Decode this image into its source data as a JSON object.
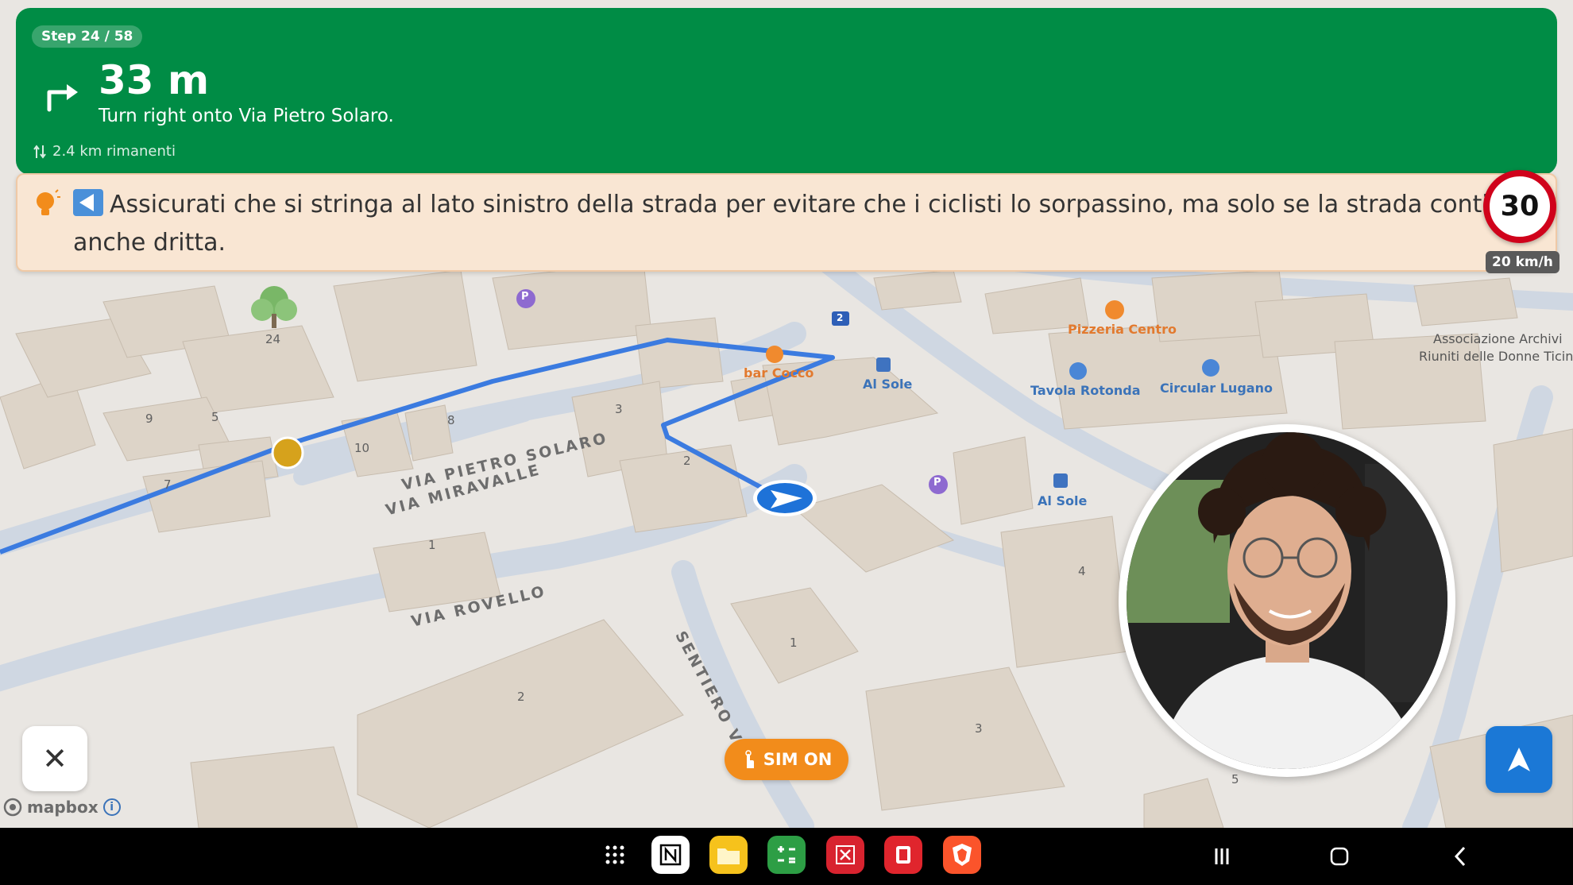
{
  "navigation": {
    "step": "Step 24 / 58",
    "distance": "33 m",
    "instruction": "Turn right onto Via Pietro Solaro.",
    "remaining": "2.4 km rimanenti",
    "turn_icon": "turn-right-icon",
    "banner_color": "#008c45"
  },
  "tip": {
    "icon": "lightbulb-icon",
    "text": "Assicurati che si stringa al lato sinistro della strada per evitare che i ciclisti lo sorpassino, ma solo se la strada continua anche dritta.",
    "background": "#f9e6d3"
  },
  "speed": {
    "limit": "30",
    "current": "20 km/h"
  },
  "map": {
    "streets": [
      "VIA PIETRO SOLARO",
      "VIA MIRAVALLE",
      "VIA ROVELLO",
      "SENTIERO VI"
    ],
    "pois": [
      "bar Cocco",
      "Al Sole",
      "Pizzeria Centro",
      "Tavola Rotonda",
      "Circular Lugano",
      "Al Sole",
      "Associazione Archivi",
      "Riuniti delle Donne Ticin"
    ],
    "building_numbers": [
      "24",
      "9",
      "5",
      "8",
      "10",
      "3",
      "2",
      "1",
      "1",
      "2",
      "3",
      "4",
      "5",
      "7"
    ],
    "route_badge": "2",
    "parking": "P",
    "route_color": "#3b7be0"
  },
  "controls": {
    "close": "✕",
    "sim": "SIM ON",
    "mapbox": "mapbox",
    "info": "i"
  },
  "taskbar": {
    "apps": [
      "apps-grid-icon",
      "notion-icon",
      "files-icon",
      "calculator-icon",
      "excel-icon",
      "flashcards-icon",
      "brave-icon"
    ],
    "system": [
      "recents-icon",
      "home-icon",
      "back-icon"
    ]
  }
}
